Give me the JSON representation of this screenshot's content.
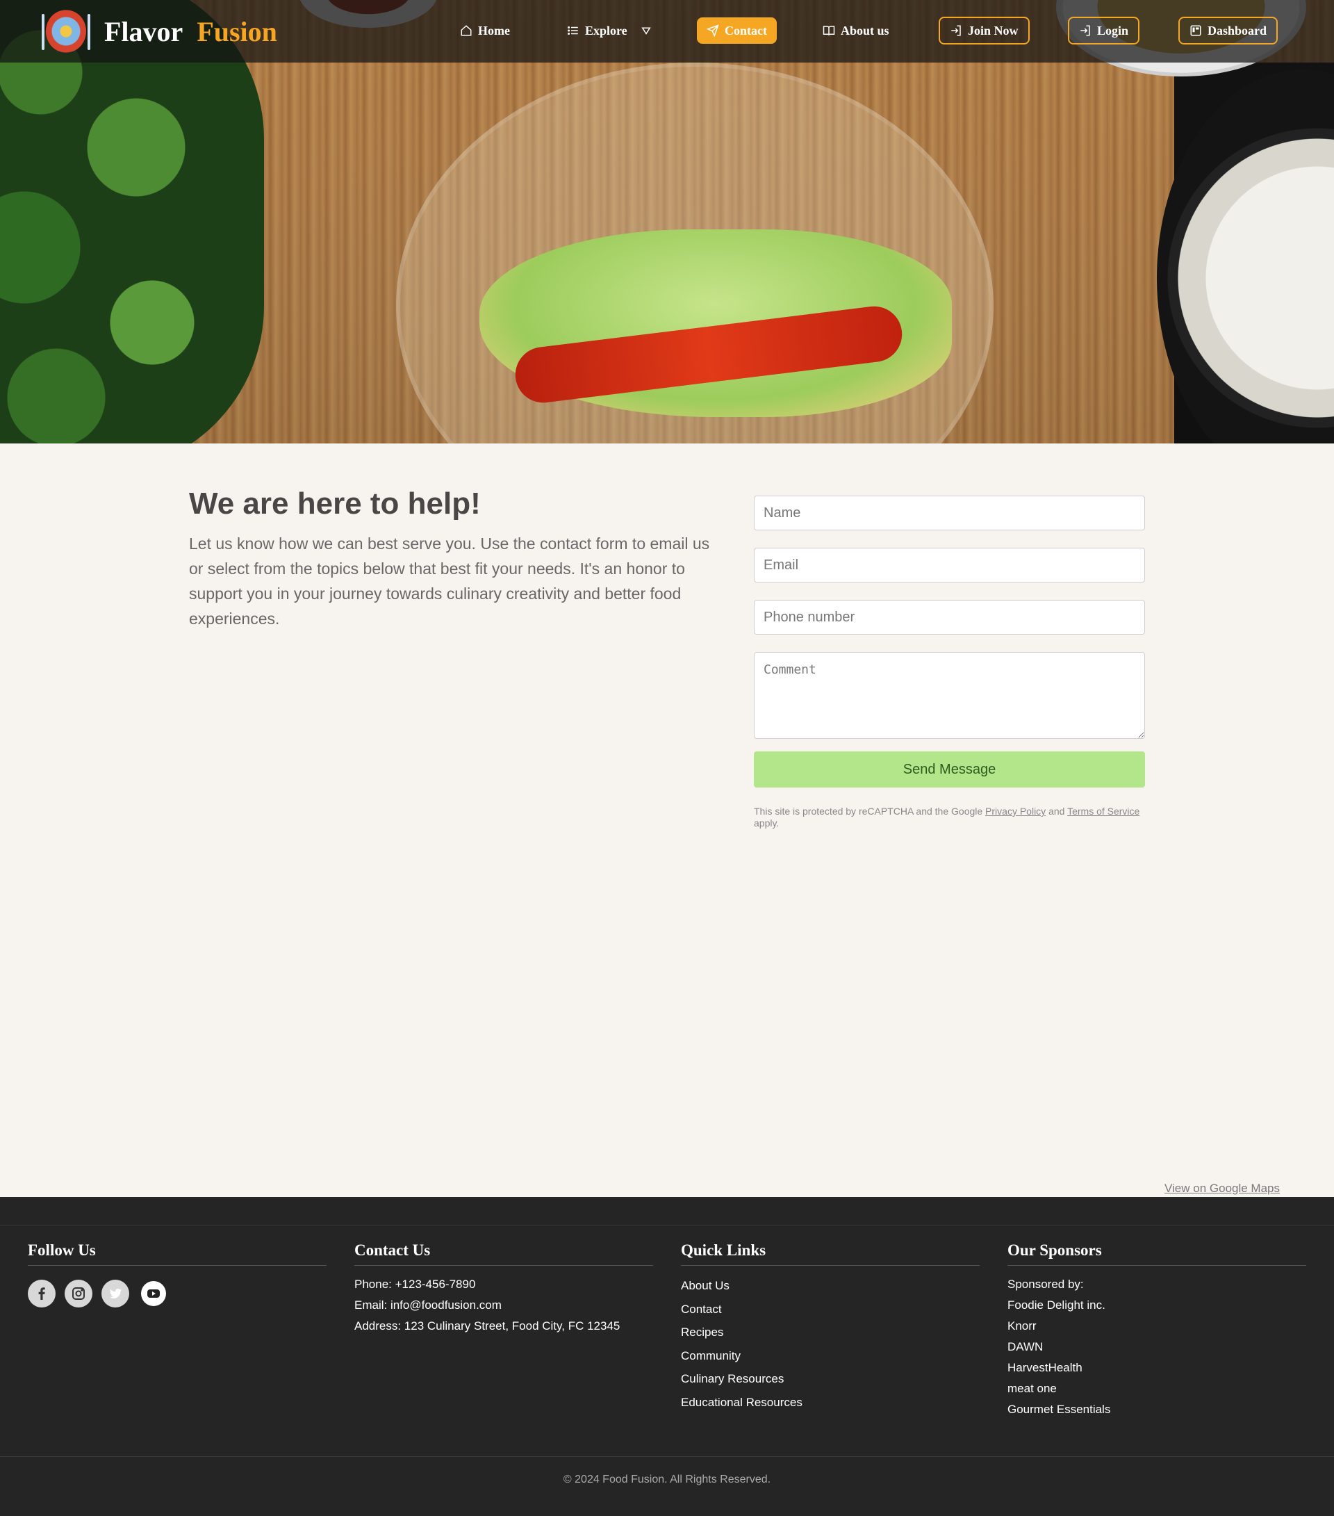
{
  "brand": {
    "name_part1": "Flavor",
    "name_part2": "Fusion",
    "accent_color": "#f5a623"
  },
  "nav": {
    "home": "Home",
    "explore": "Explore",
    "contact": "Contact",
    "about": "About us",
    "join": "Join Now",
    "login": "Login",
    "dashboard": "Dashboard"
  },
  "contact": {
    "title": "We are here to help!",
    "text": "Let us know how we can best serve you. Use the contact form to email us or select from the topics below that best fit your needs. It's an honor to support you in your journey towards culinary creativity and better food experiences.",
    "form": {
      "name_placeholder": "Name",
      "email_placeholder": "Email",
      "phone_placeholder": "Phone number",
      "comment_placeholder": "Comment",
      "send_label": "Send Message"
    },
    "recaptcha": {
      "prefix": "This site is protected by reCAPTCHA and the Google ",
      "privacy": "Privacy Policy",
      "and": " and ",
      "terms": "Terms of Service",
      "suffix": " apply."
    },
    "map_link": "View on Google Maps"
  },
  "footer": {
    "follow": {
      "title": "Follow Us",
      "icons": [
        "facebook-icon",
        "instagram-icon",
        "twitter-icon",
        "youtube-icon"
      ]
    },
    "contact": {
      "title": "Contact Us",
      "phone": "Phone: +123-456-7890",
      "email": "Email: info@foodfusion.com",
      "address": "Address: 123 Culinary Street, Food City, FC 12345"
    },
    "links": {
      "title": "Quick Links",
      "items": [
        "About Us",
        "Contact",
        "Recipes",
        "Community",
        "Culinary Resources",
        "Educational Resources"
      ]
    },
    "sponsors": {
      "title": "Our Sponsors",
      "items": [
        "Sponsored by:",
        "Foodie Delight inc.",
        "Knorr",
        "DAWN",
        "HarvestHealth",
        "meat one",
        "Gourmet Essentials"
      ]
    },
    "copyright": "© 2024 Food Fusion. All Rights Reserved."
  }
}
